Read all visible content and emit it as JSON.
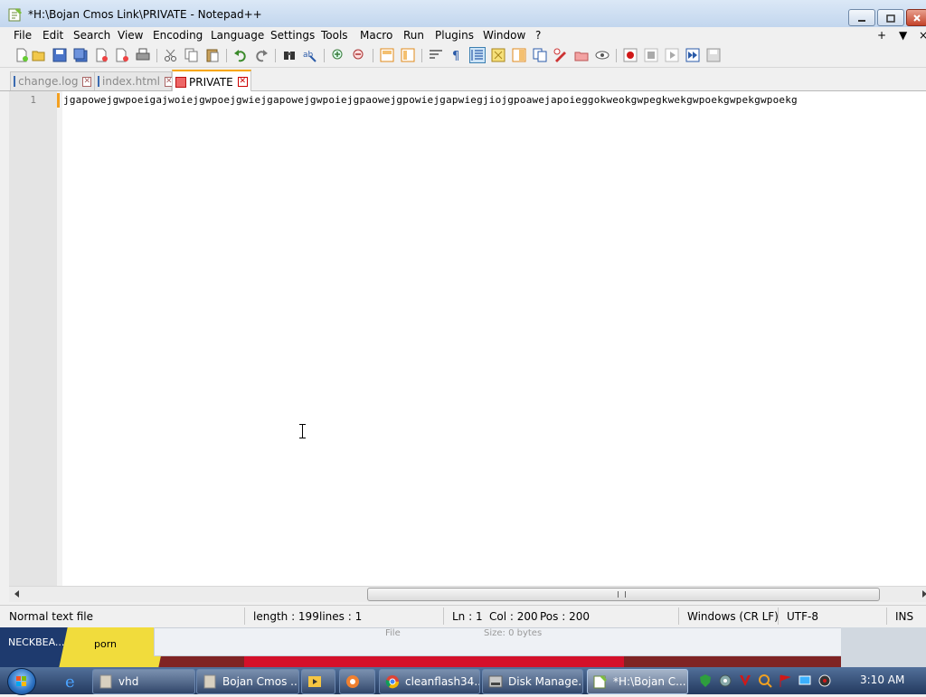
{
  "window": {
    "title": "*H:\\Bojan Cmos Link\\PRIVATE - Notepad++",
    "minimize_icon": "minimize-icon",
    "maximize_icon": "restore-icon",
    "close_icon": "close-icon"
  },
  "menu": {
    "items": [
      "File",
      "Edit",
      "Search",
      "View",
      "Encoding",
      "Language",
      "Settings",
      "Tools",
      "Macro",
      "Run",
      "Plugins",
      "Window",
      "?"
    ],
    "right": [
      "+",
      "▼",
      "×"
    ]
  },
  "toolbar": {
    "icons": [
      "new-file-icon",
      "open-file-icon",
      "save-icon",
      "save-all-icon",
      "close-icon",
      "close-all-icon",
      "print-icon",
      "cut-icon",
      "copy-icon",
      "paste-icon",
      "undo-icon",
      "redo-icon",
      "find-icon",
      "replace-icon",
      "zoom-in-icon",
      "zoom-out-icon",
      "sync-vertical-icon",
      "sync-horizontal-icon",
      "word-wrap-icon",
      "show-all-characters-icon",
      "indent-guide-icon",
      "user-language-icon",
      "doc-map-icon",
      "function-list-icon",
      "folder-workspace-icon",
      "monitoring-icon",
      "record-macro-icon",
      "stop-record-icon",
      "play-macro-icon",
      "run-macro-multiple-icon",
      "save-macro-icon"
    ]
  },
  "tabs": [
    {
      "label": "change.log",
      "active": false
    },
    {
      "label": "index.html",
      "active": false
    },
    {
      "label": "PRIVATE",
      "active": true
    }
  ],
  "editor": {
    "line_number": "1",
    "line_text": "jgapowejgwpoeigajwoiejgwpoejgwiejgapowejgwpoiejgpaowejgpowiejgapwiegjiojgpoawejapoieggokweokgwpegkwekgwpoekgwpekgwpoekg"
  },
  "status": {
    "file_type": "Normal text file",
    "length": "length : 199",
    "lines": "lines : 1",
    "ln": "Ln : 1",
    "col": "Col : 200",
    "pos": "Pos : 200",
    "eol": "Windows (CR LF)",
    "encoding": "UTF-8",
    "mode": "INS"
  },
  "desktop": {
    "text1": "NECKBEA...",
    "text2": "porn",
    "text3": "File",
    "text4": "Size: 0 bytes"
  },
  "taskbar": {
    "tasks": [
      {
        "label": "vhd",
        "icon": "app-icon"
      },
      {
        "label": "Bojan Cmos ...",
        "icon": "app-icon"
      },
      {
        "label": "",
        "icon": "media-player-icon"
      },
      {
        "label": "",
        "icon": "app-icon"
      },
      {
        "label": "cleanflash34...",
        "icon": "chrome-icon"
      },
      {
        "label": "Disk Manage...",
        "icon": "disk-management-icon"
      },
      {
        "label": "*H:\\Bojan C...",
        "icon": "notepadpp-icon"
      }
    ],
    "clock": "3:10 AM"
  }
}
